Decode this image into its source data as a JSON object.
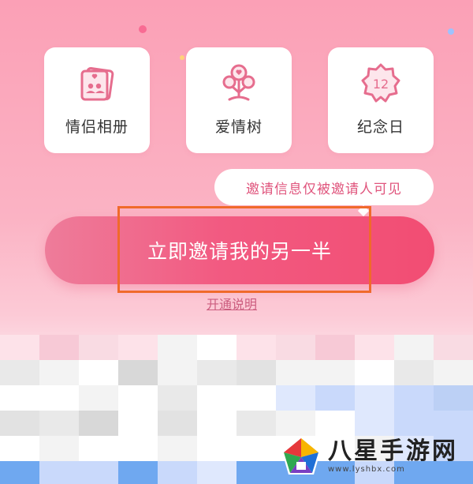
{
  "features": [
    {
      "label": "情侣相册",
      "icon": "couple-album-icon"
    },
    {
      "label": "爱情树",
      "icon": "love-tree-icon"
    },
    {
      "label": "纪念日",
      "icon": "anniversary-badge-icon",
      "badge_number": "12"
    }
  ],
  "notice": "邀请信息仅被邀请人可见",
  "invite_button": "立即邀请我的另一半",
  "explain_link": "开通说明",
  "watermark": {
    "title": "八星手游网",
    "url": "www.lyshbx.com"
  },
  "colors": {
    "accent": "#f25a81",
    "highlight": "#f06a2b",
    "icon": "#e66d8e"
  }
}
